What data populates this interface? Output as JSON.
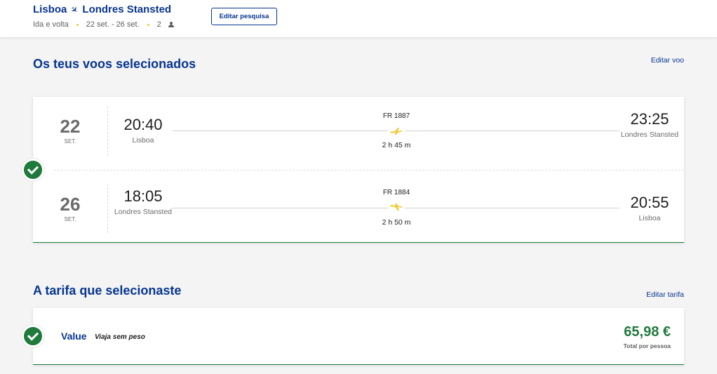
{
  "header": {
    "origin": "Lisboa",
    "destination": "Londres Stansted",
    "trip_type": "Ida e volta",
    "dates": "22 set. - 26 set.",
    "passengers": "2",
    "edit_search_label": "Editar pesquisa"
  },
  "flights_section": {
    "title": "Os teus voos selecionados",
    "edit_label": "Editar voo",
    "legs": [
      {
        "day": "22",
        "month": "SET.",
        "dep_time": "20:40",
        "dep_city": "Lisboa",
        "flight_number": "FR 1887",
        "duration": "2 h 45 m",
        "arr_time": "23:25",
        "arr_city": "Londres Stansted"
      },
      {
        "day": "26",
        "month": "SET.",
        "dep_time": "18:05",
        "dep_city": "Londres Stansted",
        "flight_number": "FR 1884",
        "duration": "2 h 50 m",
        "arr_time": "20:55",
        "arr_city": "Lisboa"
      }
    ]
  },
  "fare_section": {
    "title": "A tarifa que selecionaste",
    "edit_label": "Editar tarifa",
    "fare_name": "Value",
    "fare_desc": "Viaja sem peso",
    "price": "65,98 €",
    "price_sub": "Total por pessoa"
  },
  "colors": {
    "brand_blue": "#073590",
    "success_green": "#1f7a3c",
    "accent_yellow": "#f1c933"
  }
}
